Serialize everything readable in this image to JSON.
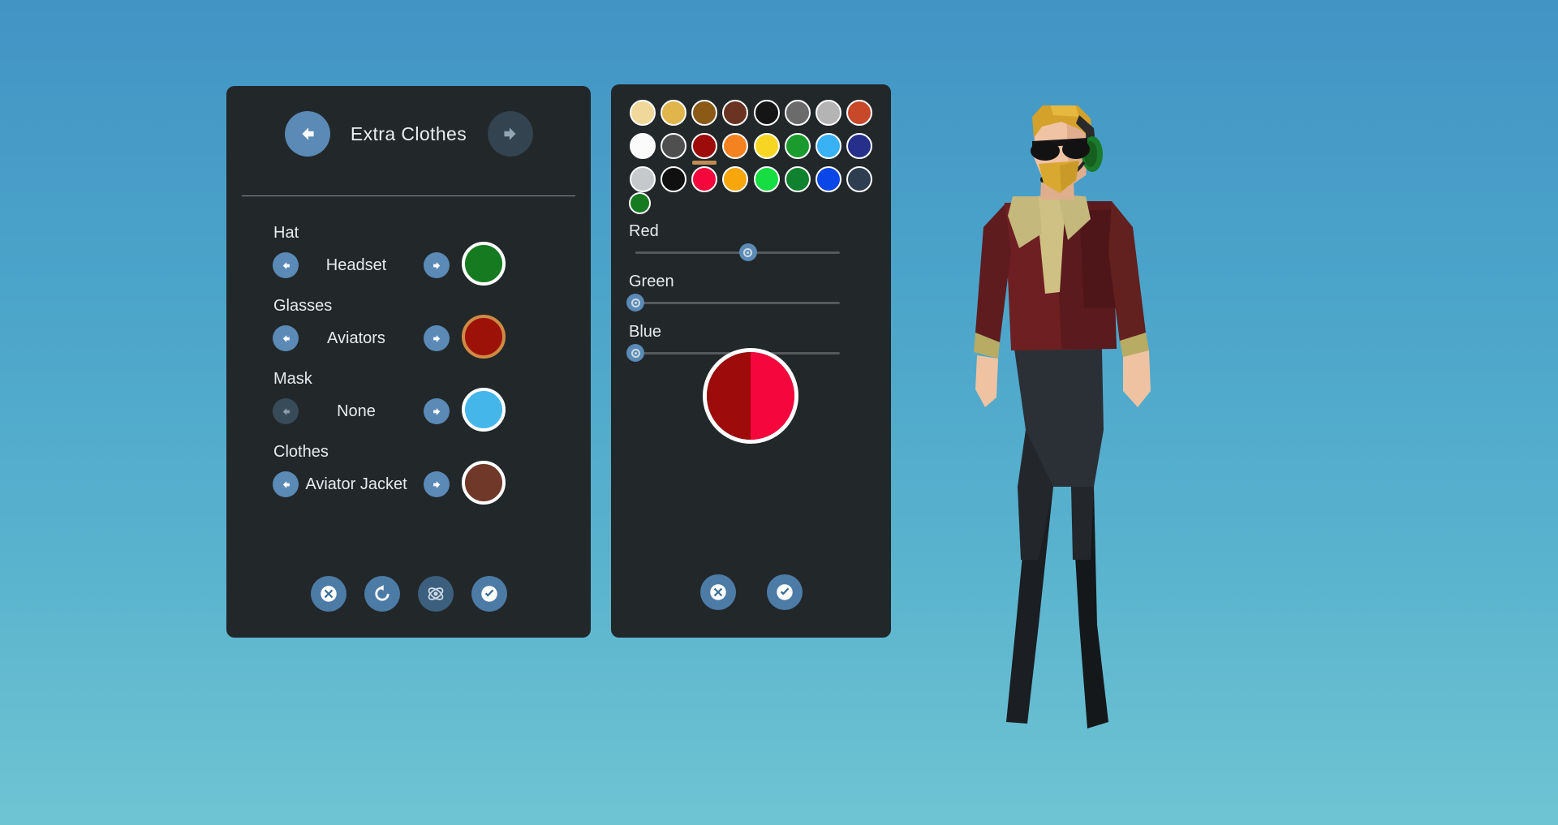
{
  "background": {
    "gradient_top": "#4294c4",
    "gradient_bottom": "#6fc4d2"
  },
  "options_panel": {
    "header": {
      "title": "Extra Clothes",
      "prev_icon": "arrow-left-icon",
      "next_icon": "arrow-right-icon",
      "prev_enabled": true,
      "next_enabled": false
    },
    "groups": [
      {
        "label": "Hat",
        "value": "Headset",
        "prev_enabled": true,
        "next_enabled": true,
        "swatch_color": "#157a20",
        "swatch_ring": "#ffffff"
      },
      {
        "label": "Glasses",
        "value": "Aviators",
        "prev_enabled": true,
        "next_enabled": true,
        "swatch_color": "#9d1208",
        "swatch_ring": "#cf8a44"
      },
      {
        "label": "Mask",
        "value": "None",
        "prev_enabled": false,
        "next_enabled": true,
        "swatch_color": "#45b6ea",
        "swatch_ring": "#ffffff"
      },
      {
        "label": "Clothes",
        "value": "Aviator Jacket",
        "prev_enabled": true,
        "next_enabled": true,
        "swatch_color": "#703828",
        "swatch_ring": "#ffffff"
      }
    ],
    "actions": [
      {
        "name": "cancel-button",
        "icon": "x-circle-icon",
        "muted": false
      },
      {
        "name": "reset-button",
        "icon": "refresh-icon",
        "muted": false
      },
      {
        "name": "randomize-button",
        "icon": "atom-icon",
        "muted": true
      },
      {
        "name": "confirm-button",
        "icon": "check-circle-icon",
        "muted": false
      }
    ]
  },
  "color_panel": {
    "palette": [
      {
        "color": "#f0d79a",
        "ring": "#ffffff",
        "selected": false
      },
      {
        "color": "#dfb54c",
        "ring": "#ffffff",
        "selected": false
      },
      {
        "color": "#8a5a16",
        "ring": "#ffffff",
        "selected": false
      },
      {
        "color": "#6b3322",
        "ring": "#ffffff",
        "selected": false
      },
      {
        "color": "#151515",
        "ring": "#ffffff",
        "selected": false
      },
      {
        "color": "#6b6b6b",
        "ring": "#ffffff",
        "selected": false
      },
      {
        "color": "#b4b4b4",
        "ring": "#ffffff",
        "selected": false
      },
      {
        "color": "#c8482a",
        "ring": "#ffffff",
        "selected": false
      },
      {
        "color": "#fbfbfb",
        "ring": "#ffffff",
        "selected": false
      },
      {
        "color": "#4f4f4f",
        "ring": "#ffffff",
        "selected": false
      },
      {
        "color": "#9d0b0b",
        "ring": "#ffffff",
        "selected": true
      },
      {
        "color": "#f58220",
        "ring": "#ffffff",
        "selected": false
      },
      {
        "color": "#f7d623",
        "ring": "#ffffff",
        "selected": false
      },
      {
        "color": "#1b9b2e",
        "ring": "#ffffff",
        "selected": false
      },
      {
        "color": "#38b1f5",
        "ring": "#ffffff",
        "selected": false
      },
      {
        "color": "#26308a",
        "ring": "#ffffff",
        "selected": false
      },
      {
        "color": "#c6c9cb",
        "ring": "#ffffff",
        "selected": false
      },
      {
        "color": "#101010",
        "ring": "#ffffff",
        "selected": false
      },
      {
        "color": "#f5063c",
        "ring": "#ffffff",
        "selected": false
      },
      {
        "color": "#f7a70c",
        "ring": "#ffffff",
        "selected": false
      },
      {
        "color": "#16dd41",
        "ring": "#ffffff",
        "selected": false
      },
      {
        "color": "#10812e",
        "ring": "#ffffff",
        "selected": false
      },
      {
        "color": "#0b47e8",
        "ring": "#ffffff",
        "selected": false
      },
      {
        "color": "#2e3e50",
        "ring": "#ffffff",
        "selected": false
      }
    ],
    "selected_underline_color": "#c08c52",
    "current_swatch_color": "#157a20",
    "channels": [
      {
        "label": "Red",
        "value_pct": 55
      },
      {
        "label": "Green",
        "value_pct": 0
      },
      {
        "label": "Blue",
        "value_pct": 0
      }
    ],
    "preview": {
      "old_color": "#9d0b0b",
      "new_color": "#f5063c"
    },
    "actions": [
      {
        "name": "cancel-button",
        "icon": "x-circle-icon",
        "muted": false
      },
      {
        "name": "confirm-button",
        "icon": "check-circle-icon",
        "muted": false
      }
    ]
  },
  "character": {
    "name": "character-preview",
    "hair_color": "#d4a12a",
    "skin_color": "#f0c3a4",
    "jacket_color": "#6e1f22",
    "scarf_color": "#cfc183",
    "pants_color": "#2b3036",
    "headset_color": "#1c7a2c"
  }
}
